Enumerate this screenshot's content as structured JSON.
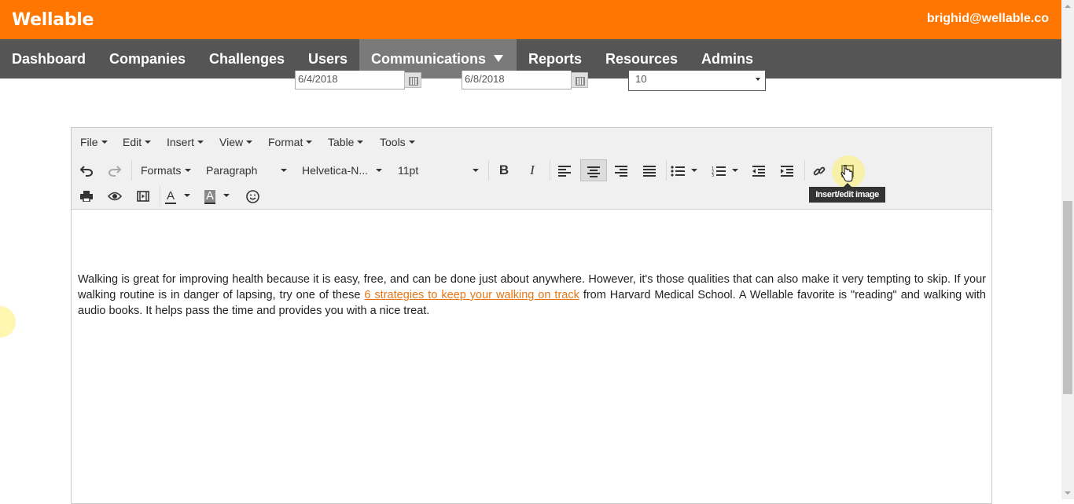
{
  "brand": {
    "logo": "Wellable",
    "user_email": "brighid@wellable.co",
    "accent": "#ff7700"
  },
  "nav": {
    "items": [
      {
        "label": "Dashboard"
      },
      {
        "label": "Companies"
      },
      {
        "label": "Challenges"
      },
      {
        "label": "Users"
      },
      {
        "label": "Communications",
        "active": true
      },
      {
        "label": "Reports"
      },
      {
        "label": "Resources"
      },
      {
        "label": "Admins"
      }
    ]
  },
  "filters": {
    "start_date": "6/4/2018",
    "end_date": "6/8/2018",
    "count": "10"
  },
  "editor": {
    "menu": [
      "File",
      "Edit",
      "Insert",
      "View",
      "Format",
      "Table",
      "Tools"
    ],
    "formats_label": "Formats",
    "block_label": "Paragraph",
    "font_label": "Helvetica-N...",
    "size_label": "11pt",
    "tooltip": "Insert/edit image",
    "body": {
      "text_before": "Walking is great for improving health because it is easy, free, and can be done just about anywhere. However, it's those qualities that can also make it very tempting to skip. If your walking routine is in danger of lapsing, try one of these ",
      "link_text": "6 strategies to keep your walking on track",
      "text_after": " from Harvard Medical School. A Wellable favorite is \"reading\" and walking with audio books. It helps pass the time and provides you with a nice treat."
    }
  },
  "icons": {
    "undo": "undo-icon",
    "redo": "redo-icon",
    "bold": "bold-icon",
    "italic": "italic-icon",
    "align_left": "align-left-icon",
    "align_center": "align-center-icon",
    "align_right": "align-right-icon",
    "justify": "justify-icon",
    "bullets": "bullet-list-icon",
    "numbers": "numbered-list-icon",
    "outdent": "outdent-icon",
    "indent": "indent-icon",
    "link": "link-icon",
    "image": "image-icon",
    "print": "print-icon",
    "preview": "eye-icon",
    "media": "media-icon",
    "text_color": "text-color-icon",
    "bg_color": "background-color-icon",
    "emoji": "emoticon-icon"
  }
}
